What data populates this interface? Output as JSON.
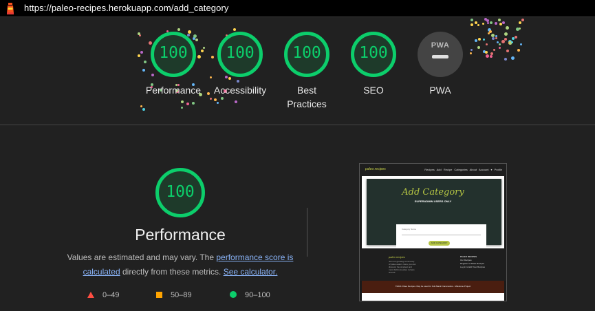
{
  "url": "https://paleo-recipes.herokuapp.com/add_category",
  "gauges": [
    {
      "label": "Performance",
      "score": "100"
    },
    {
      "label": "Accessibility",
      "score": "100"
    },
    {
      "label": "Best Practices",
      "score": "100"
    },
    {
      "label": "SEO",
      "score": "100"
    },
    {
      "label": "PWA",
      "score": ""
    }
  ],
  "pwa_badge_text": "PWA",
  "main": {
    "score": "100",
    "title": "Performance",
    "desc_part1": "Values are estimated and may vary. The ",
    "desc_link1": "performance score is calculated",
    "desc_part2": " directly from these metrics. ",
    "desc_link2": "See calculator."
  },
  "legend": [
    {
      "range": "0–49",
      "color": "#ff4e42"
    },
    {
      "range": "50–89",
      "color": "#ffa400"
    },
    {
      "range": "90–100",
      "color": "#0cce6b"
    }
  ],
  "thumbnail": {
    "brand": "paleo recipes",
    "nav_links": "Recipes  Add Recipe  Categories  About  Account ▾  Profile",
    "hero_title": "Add Category",
    "hero_subtitle": "SUPERADMIN USERS ONLY",
    "form_label": "Category Name",
    "button": "ADD CATEGORY",
    "footer_brand": "paleo recipes",
    "footer_text": "Join our growing community of paleo eaters. Here you can discover the simplest and most delicious paleo recipes around.",
    "footer_links": [
      "PALEO RECIPES",
      "Our Recipes",
      "Register to Share Recipes",
      "Log in to Edit Your Recipes"
    ],
    "bottom_bar": "©2021 Paleo Recipes. May be used for Full-Stack Frameworks - Milestone Project"
  }
}
